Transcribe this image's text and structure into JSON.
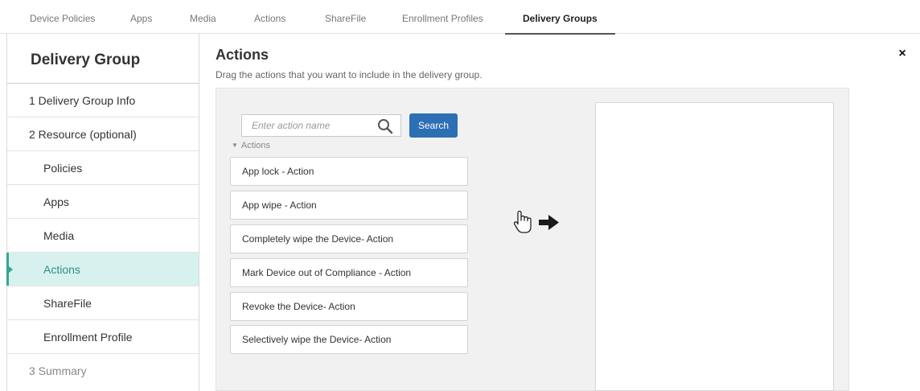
{
  "tabs": [
    {
      "label": "Device Policies"
    },
    {
      "label": "Apps"
    },
    {
      "label": "Media"
    },
    {
      "label": "Actions"
    },
    {
      "label": "ShareFile"
    },
    {
      "label": "Enrollment Profiles"
    },
    {
      "label": "Delivery Groups",
      "active": true
    }
  ],
  "sidebar": {
    "title": "Delivery Group",
    "items": [
      {
        "label": "1  Delivery Group Info"
      },
      {
        "label": "2  Resource (optional)"
      },
      {
        "label": "Policies"
      },
      {
        "label": "Apps"
      },
      {
        "label": "Media"
      },
      {
        "label": "Actions",
        "active": true
      },
      {
        "label": "ShareFile"
      },
      {
        "label": "Enrollment Profile"
      },
      {
        "label": "3  Summary"
      }
    ]
  },
  "main": {
    "title": "Actions",
    "subtitle": "Drag the actions that you want to include in the delivery group.",
    "close_glyph": "×",
    "search": {
      "placeholder": "Enter action name",
      "value": "",
      "button_label": "Search",
      "icon": "search-icon"
    },
    "group_label": "Actions",
    "group_caret": "▼",
    "actions": [
      "App lock - Action",
      "App wipe - Action",
      "Completely wipe the Device- Action",
      "Mark Device out of Compliance - Action",
      "Revoke the Device- Action",
      "Selectively wipe the Device- Action"
    ],
    "drag_hint_icons": [
      "hand-pointer-icon",
      "arrow-right-icon"
    ]
  },
  "colors": {
    "active_tab_underline": "#555555",
    "sidebar_active_bg": "#d7f2ee",
    "sidebar_active_accent": "#36a695",
    "search_button": "#2c6fb5",
    "panel_bg": "#f1f1f1"
  }
}
